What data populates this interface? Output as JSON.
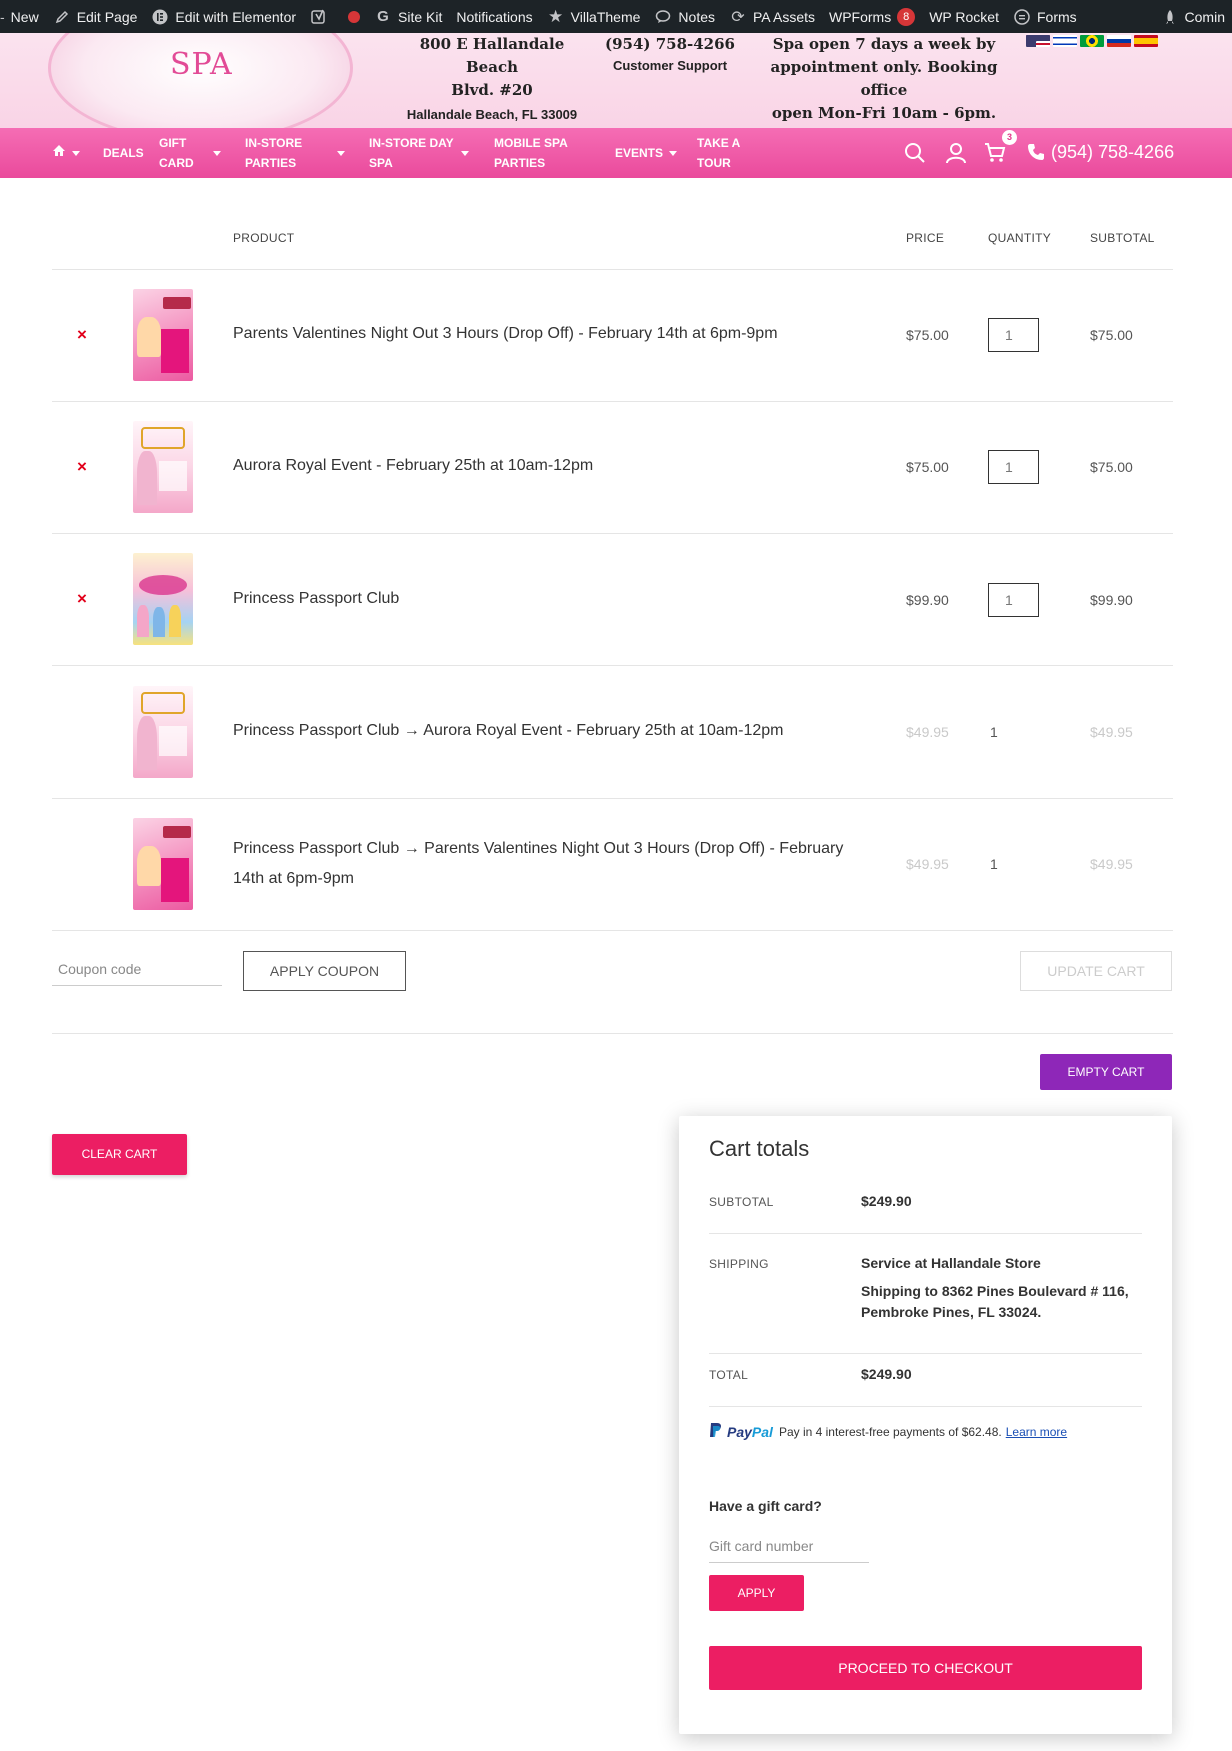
{
  "admin_bar": {
    "items": [
      {
        "icon": "plus-icon",
        "label": "New"
      },
      {
        "icon": "pencil-icon",
        "label": "Edit Page"
      },
      {
        "icon": "elementor-icon",
        "label": "Edit with Elementor"
      },
      {
        "icon": "yoast-icon",
        "label": ""
      },
      {
        "icon": "status-dot-icon",
        "label": ""
      },
      {
        "icon": "google-icon",
        "label": "Site Kit"
      },
      {
        "icon": "",
        "label": "Notifications"
      },
      {
        "icon": "star-icon",
        "label": "VillaTheme"
      },
      {
        "icon": "speech-bubble-icon",
        "label": "Notes"
      },
      {
        "icon": "refresh-icon",
        "label": "PA Assets"
      },
      {
        "icon": "",
        "label": "WPForms",
        "badge": "8"
      },
      {
        "icon": "",
        "label": "WP Rocket"
      },
      {
        "icon": "forms-icon",
        "label": "Forms"
      }
    ],
    "right_label": "Comin"
  },
  "header": {
    "logo_text": "SPA",
    "address_line1": "800 E Hallandale Beach",
    "address_line2": "Blvd. #20",
    "address_line3": "Hallandale Beach, FL 33009",
    "phone": "(954) 758-4266",
    "phone_caption": "Customer Support",
    "hours_line1": "Spa open 7 days a week by",
    "hours_line2": "appointment only. Booking office",
    "hours_line3": "open Mon-Fri 10am - 6pm."
  },
  "nav": {
    "deals": "DEALS",
    "gift_card_1": "GIFT",
    "gift_card_2": "CARD",
    "instore_1": "IN-STORE",
    "instore_2": "PARTIES",
    "dayspa_1": "IN-STORE DAY",
    "dayspa_2": "SPA",
    "mobile_1": "MOBILE SPA",
    "mobile_2": "PARTIES",
    "events": "EVENTS",
    "tour_1": "TAKE A",
    "tour_2": "TOUR",
    "cart_count": "3",
    "phone": "(954) 758-4266"
  },
  "cart": {
    "headers": {
      "product": "PRODUCT",
      "price": "PRICE",
      "quantity": "QUANTITY",
      "subtotal": "SUBTOTAL"
    },
    "items": [
      {
        "name": "Parents Valentines Night Out 3 Hours (Drop Off) - February 14th at 6pm-9pm",
        "price": "$75.00",
        "qty": "1",
        "subtotal": "$75.00",
        "removable": true
      },
      {
        "name": "Aurora Royal Event - February 25th at 10am-12pm",
        "price": "$75.00",
        "qty": "1",
        "subtotal": "$75.00",
        "removable": true
      },
      {
        "name": "Princess Passport Club",
        "price": "$99.90",
        "qty": "1",
        "subtotal": "$99.90",
        "removable": true
      },
      {
        "name": "Princess Passport Club → Aurora Royal Event - February 25th at 10am-12pm",
        "price": "$49.95",
        "qty": "1",
        "subtotal": "$49.95",
        "removable": false
      },
      {
        "name": "Princess Passport Club → Parents Valentines Night Out 3 Hours (Drop Off) - February 14th at 6pm-9pm",
        "price": "$49.95",
        "qty": "1",
        "subtotal": "$49.95",
        "removable": false
      }
    ],
    "remove_symbol": "×",
    "coupon_placeholder": "Coupon code",
    "apply_coupon": "APPLY COUPON",
    "update_cart": "UPDATE CART",
    "empty_cart": "EMPTY CART",
    "clear_cart": "CLEAR CART"
  },
  "totals": {
    "title": "Cart totals",
    "subtotal_label": "SUBTOTAL",
    "subtotal_value": "$249.90",
    "shipping_label": "SHIPPING",
    "shipping_method": "Service at Hallandale Store",
    "shipping_dest_1": "Shipping to 8362 Pines Boulevard # 116,",
    "shipping_dest_2": "Pembroke Pines, FL 33024.",
    "total_label": "TOTAL",
    "total_value": "$249.90",
    "paypal_brand_1": "Pay",
    "paypal_brand_2": "Pal",
    "paypal_text": "Pay in 4 interest-free payments of $62.48.",
    "paypal_link": "Learn more",
    "gift_heading": "Have a gift card?",
    "gift_placeholder": "Gift card number",
    "apply": "APPLY",
    "checkout": "PROCEED TO CHECKOUT"
  },
  "colors": {
    "brand_pink": "#ea4a9c",
    "button_pink": "#ec1e63",
    "button_purple": "#8e27b8",
    "admin_bar": "#1d2327"
  }
}
